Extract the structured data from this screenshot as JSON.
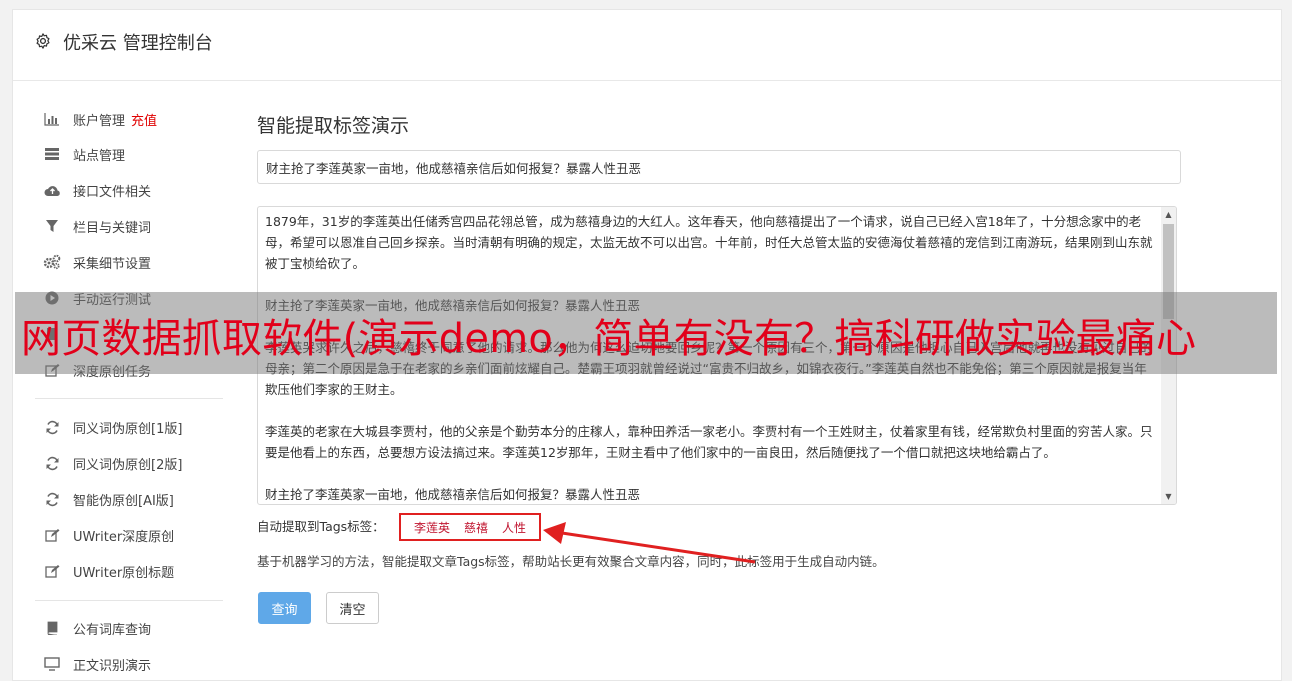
{
  "header": {
    "title": "优采云 管理控制台",
    "icon": "gear-icon"
  },
  "sidebar": {
    "items": [
      {
        "label": "账户管理",
        "badge": "充值",
        "icon": "bar-chart-icon"
      },
      {
        "label": "站点管理",
        "icon": "server-icon"
      },
      {
        "label": "接口文件相关",
        "icon": "cloud-upload-icon"
      },
      {
        "label": "栏目与关键词",
        "icon": "filter-icon"
      },
      {
        "label": "采集细节设置",
        "icon": "gears-icon"
      },
      {
        "label": "手动运行测试",
        "icon": "play-icon"
      },
      {
        "label": "",
        "icon": "book-icon"
      },
      {
        "label": "深度原创任务",
        "icon": "edit-icon"
      },
      {
        "label": "同义词伪原创[1版]",
        "icon": "refresh-icon"
      },
      {
        "label": "同义词伪原创[2版]",
        "icon": "refresh-icon"
      },
      {
        "label": "智能伪原创[AI版]",
        "icon": "refresh-icon"
      },
      {
        "label": "UWriter深度原创",
        "icon": "edit-icon"
      },
      {
        "label": "UWriter原创标题",
        "icon": "edit-icon"
      },
      {
        "label": "公有词库查询",
        "icon": "book-icon"
      },
      {
        "label": "正文识别演示",
        "icon": "monitor-icon"
      }
    ]
  },
  "main": {
    "title": "智能提取标签演示",
    "title_input_value": "财主抢了李莲英家一亩地，他成慈禧亲信后如何报复？暴露人性丑恶",
    "content_paragraphs": [
      "1879年，31岁的李莲英出任储秀宫四品花翎总管，成为慈禧身边的大红人。这年春天，他向慈禧提出了一个请求，说自己已经入宫18年了，十分想念家中的老母，希望可以恩准自己回乡探亲。当时清朝有明确的规定，太监无故不可以出宫。十年前，时任大总管太监的安德海仗着慈禧的宠信到江南游玩，结果刚到山东就被丁宝桢给砍了。",
      "财主抢了李莲英家一亩地，他成慈禧亲信后如何报复？暴露人性丑恶",
      "李莲英哭求许久之后，慈禧终于同意了他的请求。那么他为何这么迫切地要回乡呢？第一个原因有三个，第一个原因是他担心自己入宫后他就再也没有见过自己的母亲；第二个原因是急于在老家的乡亲们面前炫耀自己。楚霸王项羽就曾经说过“富贵不归故乡，如锦衣夜行。”李莲英自然也不能免俗；第三个原因就是报复当年欺压他们李家的王财主。",
      "李莲英的老家在大城县李贾村，他的父亲是个勤劳本分的庄稼人，靠种田养活一家老小。李贾村有一个王姓财主，仗着家里有钱，经常欺负村里面的穷苦人家。只要是他看上的东西，总要想方设法搞过来。李莲英12岁那年，王财主看中了他们家中的一亩良田，然后随便找了一个借口就把这块地给霸占了。",
      "财主抢了李莲英家一亩地，他成慈禧亲信后如何报复？暴露人性丑恶"
    ],
    "tags_label": "自动提取到Tags标签：",
    "tags": [
      "李莲英",
      "慈禧",
      "人性"
    ],
    "description": "基于机器学习的方法，智能提取文章Tags标签，帮助站长更有效聚合文章内容，同时，此标签用于生成自动内链。",
    "buttons": {
      "query": "查询",
      "clear": "清空"
    }
  },
  "overlay": {
    "text": "网页数据抓取软件(演示demo，简单有没有？搞科研做实验最痛心"
  },
  "colors": {
    "accent_button": "#5fa8e8",
    "tag_red": "#c0142f",
    "highlight_red": "#e02020"
  }
}
